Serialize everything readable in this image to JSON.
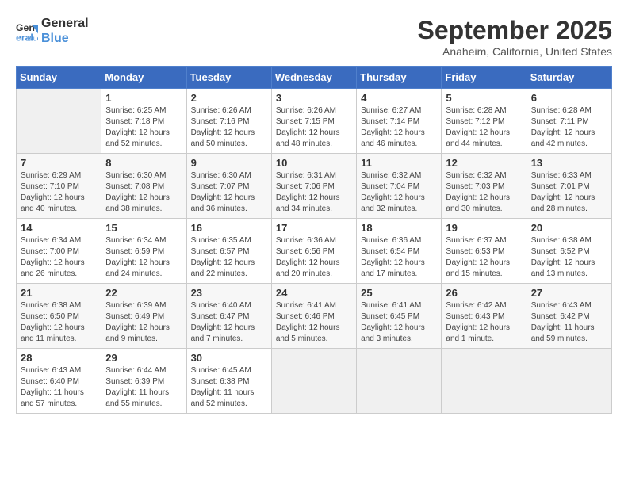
{
  "header": {
    "logo_line1": "General",
    "logo_line2": "Blue",
    "month": "September 2025",
    "location": "Anaheim, California, United States"
  },
  "weekdays": [
    "Sunday",
    "Monday",
    "Tuesday",
    "Wednesday",
    "Thursday",
    "Friday",
    "Saturday"
  ],
  "weeks": [
    [
      {
        "day": "",
        "info": ""
      },
      {
        "day": "1",
        "info": "Sunrise: 6:25 AM\nSunset: 7:18 PM\nDaylight: 12 hours\nand 52 minutes."
      },
      {
        "day": "2",
        "info": "Sunrise: 6:26 AM\nSunset: 7:16 PM\nDaylight: 12 hours\nand 50 minutes."
      },
      {
        "day": "3",
        "info": "Sunrise: 6:26 AM\nSunset: 7:15 PM\nDaylight: 12 hours\nand 48 minutes."
      },
      {
        "day": "4",
        "info": "Sunrise: 6:27 AM\nSunset: 7:14 PM\nDaylight: 12 hours\nand 46 minutes."
      },
      {
        "day": "5",
        "info": "Sunrise: 6:28 AM\nSunset: 7:12 PM\nDaylight: 12 hours\nand 44 minutes."
      },
      {
        "day": "6",
        "info": "Sunrise: 6:28 AM\nSunset: 7:11 PM\nDaylight: 12 hours\nand 42 minutes."
      }
    ],
    [
      {
        "day": "7",
        "info": "Sunrise: 6:29 AM\nSunset: 7:10 PM\nDaylight: 12 hours\nand 40 minutes."
      },
      {
        "day": "8",
        "info": "Sunrise: 6:30 AM\nSunset: 7:08 PM\nDaylight: 12 hours\nand 38 minutes."
      },
      {
        "day": "9",
        "info": "Sunrise: 6:30 AM\nSunset: 7:07 PM\nDaylight: 12 hours\nand 36 minutes."
      },
      {
        "day": "10",
        "info": "Sunrise: 6:31 AM\nSunset: 7:06 PM\nDaylight: 12 hours\nand 34 minutes."
      },
      {
        "day": "11",
        "info": "Sunrise: 6:32 AM\nSunset: 7:04 PM\nDaylight: 12 hours\nand 32 minutes."
      },
      {
        "day": "12",
        "info": "Sunrise: 6:32 AM\nSunset: 7:03 PM\nDaylight: 12 hours\nand 30 minutes."
      },
      {
        "day": "13",
        "info": "Sunrise: 6:33 AM\nSunset: 7:01 PM\nDaylight: 12 hours\nand 28 minutes."
      }
    ],
    [
      {
        "day": "14",
        "info": "Sunrise: 6:34 AM\nSunset: 7:00 PM\nDaylight: 12 hours\nand 26 minutes."
      },
      {
        "day": "15",
        "info": "Sunrise: 6:34 AM\nSunset: 6:59 PM\nDaylight: 12 hours\nand 24 minutes."
      },
      {
        "day": "16",
        "info": "Sunrise: 6:35 AM\nSunset: 6:57 PM\nDaylight: 12 hours\nand 22 minutes."
      },
      {
        "day": "17",
        "info": "Sunrise: 6:36 AM\nSunset: 6:56 PM\nDaylight: 12 hours\nand 20 minutes."
      },
      {
        "day": "18",
        "info": "Sunrise: 6:36 AM\nSunset: 6:54 PM\nDaylight: 12 hours\nand 17 minutes."
      },
      {
        "day": "19",
        "info": "Sunrise: 6:37 AM\nSunset: 6:53 PM\nDaylight: 12 hours\nand 15 minutes."
      },
      {
        "day": "20",
        "info": "Sunrise: 6:38 AM\nSunset: 6:52 PM\nDaylight: 12 hours\nand 13 minutes."
      }
    ],
    [
      {
        "day": "21",
        "info": "Sunrise: 6:38 AM\nSunset: 6:50 PM\nDaylight: 12 hours\nand 11 minutes."
      },
      {
        "day": "22",
        "info": "Sunrise: 6:39 AM\nSunset: 6:49 PM\nDaylight: 12 hours\nand 9 minutes."
      },
      {
        "day": "23",
        "info": "Sunrise: 6:40 AM\nSunset: 6:47 PM\nDaylight: 12 hours\nand 7 minutes."
      },
      {
        "day": "24",
        "info": "Sunrise: 6:41 AM\nSunset: 6:46 PM\nDaylight: 12 hours\nand 5 minutes."
      },
      {
        "day": "25",
        "info": "Sunrise: 6:41 AM\nSunset: 6:45 PM\nDaylight: 12 hours\nand 3 minutes."
      },
      {
        "day": "26",
        "info": "Sunrise: 6:42 AM\nSunset: 6:43 PM\nDaylight: 12 hours\nand 1 minute."
      },
      {
        "day": "27",
        "info": "Sunrise: 6:43 AM\nSunset: 6:42 PM\nDaylight: 11 hours\nand 59 minutes."
      }
    ],
    [
      {
        "day": "28",
        "info": "Sunrise: 6:43 AM\nSunset: 6:40 PM\nDaylight: 11 hours\nand 57 minutes."
      },
      {
        "day": "29",
        "info": "Sunrise: 6:44 AM\nSunset: 6:39 PM\nDaylight: 11 hours\nand 55 minutes."
      },
      {
        "day": "30",
        "info": "Sunrise: 6:45 AM\nSunset: 6:38 PM\nDaylight: 11 hours\nand 52 minutes."
      },
      {
        "day": "",
        "info": ""
      },
      {
        "day": "",
        "info": ""
      },
      {
        "day": "",
        "info": ""
      },
      {
        "day": "",
        "info": ""
      }
    ]
  ]
}
